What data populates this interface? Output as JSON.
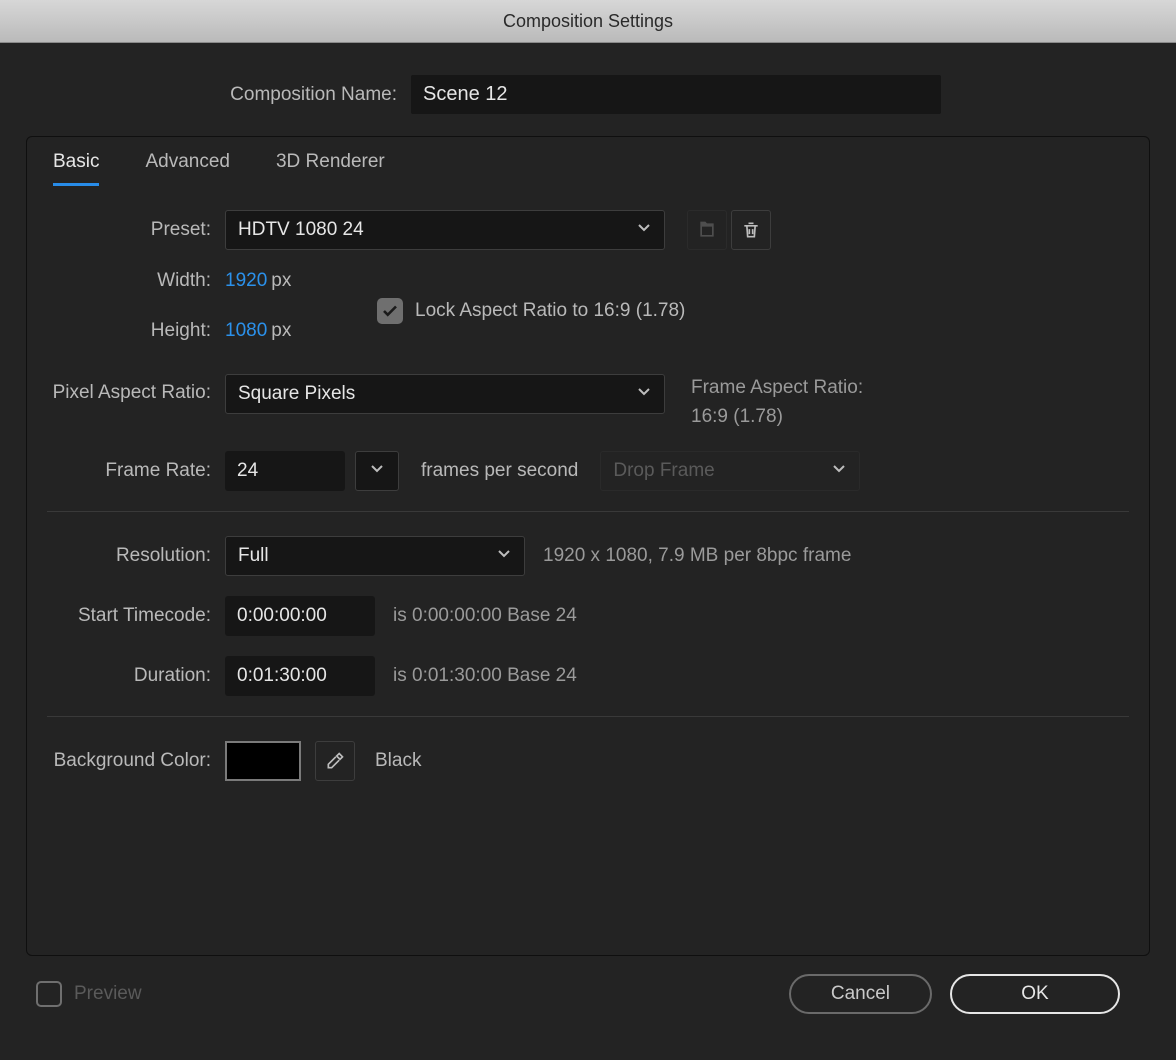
{
  "window": {
    "title": "Composition Settings"
  },
  "name": {
    "label": "Composition Name:",
    "value": "Scene 12"
  },
  "tabs": {
    "basic": "Basic",
    "advanced": "Advanced",
    "renderer": "3D Renderer"
  },
  "preset": {
    "label": "Preset:",
    "value": "HDTV 1080 24"
  },
  "dimensions": {
    "width_label": "Width:",
    "width_value": "1920",
    "width_unit": "px",
    "height_label": "Height:",
    "height_value": "1080",
    "height_unit": "px",
    "lock_label": "Lock Aspect Ratio to 16:9 (1.78)"
  },
  "par": {
    "label": "Pixel Aspect Ratio:",
    "value": "Square Pixels",
    "frame_label": "Frame Aspect Ratio:",
    "frame_value": "16:9 (1.78)"
  },
  "framerate": {
    "label": "Frame Rate:",
    "value": "24",
    "units": "frames per second",
    "dropframe": "Drop Frame"
  },
  "resolution": {
    "label": "Resolution:",
    "value": "Full",
    "info": "1920 x 1080, 7.9 MB per 8bpc frame"
  },
  "start": {
    "label": "Start Timecode:",
    "value": "0:00:00:00",
    "info": "is 0:00:00:00  Base 24"
  },
  "duration": {
    "label": "Duration:",
    "value": "0:01:30:00",
    "info": "is 0:01:30:00  Base 24"
  },
  "bg": {
    "label": "Background Color:",
    "name": "Black",
    "hex": "#000000"
  },
  "footer": {
    "preview": "Preview",
    "cancel": "Cancel",
    "ok": "OK"
  }
}
